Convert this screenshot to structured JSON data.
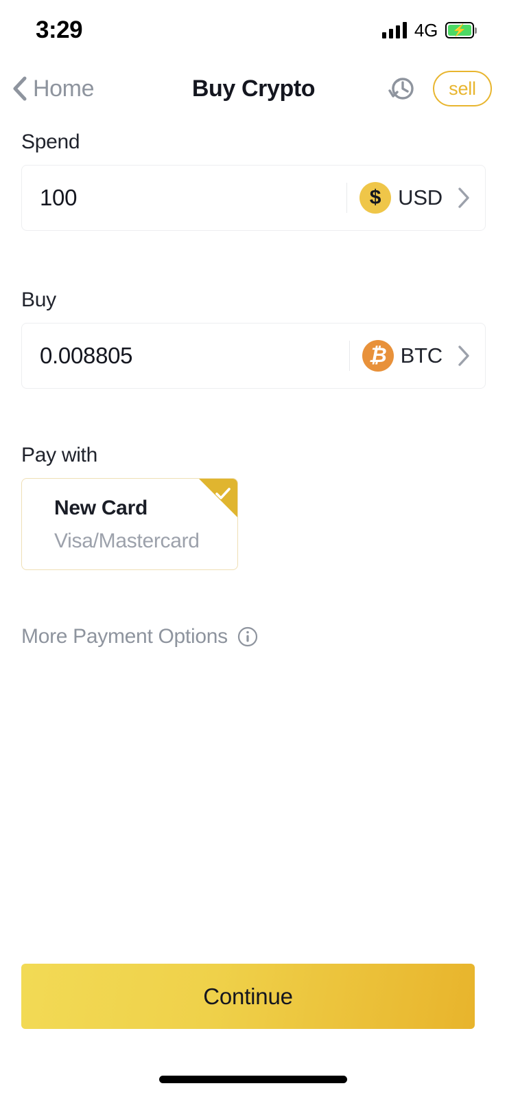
{
  "status_bar": {
    "time": "3:29",
    "network": "4G",
    "signal_icon": "signal-bars-icon",
    "battery_icon": "battery-charging-icon",
    "battery_color": "#4CD964"
  },
  "navbar": {
    "back_label": "Home",
    "back_icon": "chevron-left-icon",
    "title": "Buy Crypto",
    "history_icon": "history-clock-icon",
    "sell_label": "sell",
    "accent_color": "#E8B52E"
  },
  "spend": {
    "label": "Spend",
    "value": "100",
    "placeholder": "0",
    "asset_code": "USD",
    "asset_icon": "usd-coin-icon",
    "asset_symbol": "$",
    "asset_color": "#EFC649",
    "chevron_icon": "chevron-right-icon"
  },
  "buy": {
    "label": "Buy",
    "value": "0.008805",
    "placeholder": "0",
    "asset_code": "BTC",
    "asset_icon": "bitcoin-coin-icon",
    "asset_symbol": "₿",
    "asset_color": "#E8913A",
    "chevron_icon": "chevron-right-icon"
  },
  "pay_with": {
    "label": "Pay with",
    "card": {
      "title": "New Card",
      "subtitle": "Visa/Mastercard",
      "selected": true,
      "badge_icon": "check-icon",
      "badge_color": "#E0B52F"
    },
    "more_options_label": "More Payment Options",
    "more_options_icon": "info-circle-icon"
  },
  "footer": {
    "continue_label": "Continue",
    "gradient_from": "#F2DA55",
    "gradient_to": "#E8B42C",
    "home_indicator": "home-indicator"
  }
}
